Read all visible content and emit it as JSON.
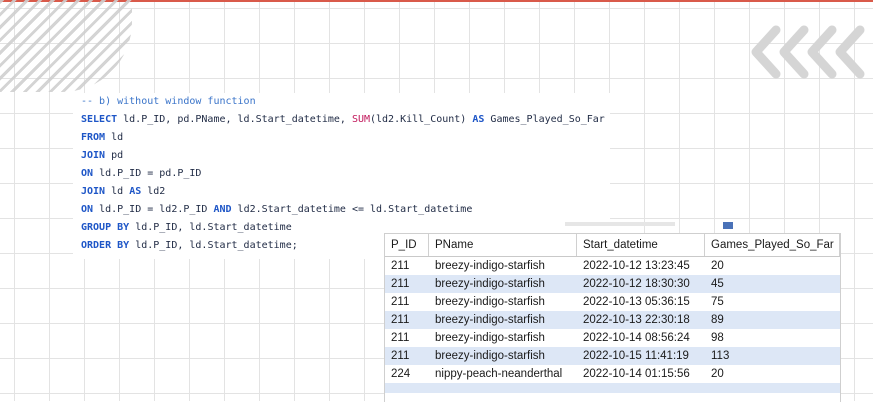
{
  "code": {
    "comment": "-- b) without window function",
    "lines": [
      {
        "kw1": "SELECT",
        "t1": " ld.P_ID, pd.PName, ld.Start_datetime, ",
        "fn": "SUM",
        "t2": "(ld2.Kill_Count) ",
        "kw2": "AS",
        "t3": " Games_Played_So_Far"
      },
      {
        "kw1": "FROM",
        "t1": " ld"
      },
      {
        "kw1": "JOIN",
        "t1": " pd"
      },
      {
        "kw1": "ON",
        "t1": " ld.P_ID = pd.P_ID"
      },
      {
        "kw1": "JOIN",
        "t1": " ld ",
        "kw2": "AS",
        "t3": " ld2"
      },
      {
        "kw1": "ON",
        "t1": " ld.P_ID = ld2.P_ID ",
        "kw2": "AND",
        "t3": " ld2.Start_datetime <= ld.Start_datetime"
      },
      {
        "kw1": "GROUP BY",
        "t1": " ld.P_ID, ld.Start_datetime"
      },
      {
        "kw1": "ORDER BY",
        "t1": " ld.P_ID, ld.Start_datetime;"
      }
    ]
  },
  "result": {
    "headers": [
      "P_ID",
      "PName",
      "Start_datetime",
      "Games_Played_So_Far"
    ],
    "rows": [
      [
        "211",
        "breezy-indigo-starfish",
        "2022-10-12 13:23:45",
        "20"
      ],
      [
        "211",
        "breezy-indigo-starfish",
        "2022-10-12 18:30:30",
        "45"
      ],
      [
        "211",
        "breezy-indigo-starfish",
        "2022-10-13 05:36:15",
        "75"
      ],
      [
        "211",
        "breezy-indigo-starfish",
        "2022-10-13 22:30:18",
        "89"
      ],
      [
        "211",
        "breezy-indigo-starfish",
        "2022-10-14 08:56:24",
        "98"
      ],
      [
        "211",
        "breezy-indigo-starfish",
        "2022-10-15 11:41:19",
        "113"
      ],
      [
        "224",
        "nippy-peach-neanderthal",
        "2022-10-14 01:15:56",
        "20"
      ]
    ]
  },
  "decor": {
    "accent": "#d95a4a",
    "chevron": "#d5d5d5"
  }
}
